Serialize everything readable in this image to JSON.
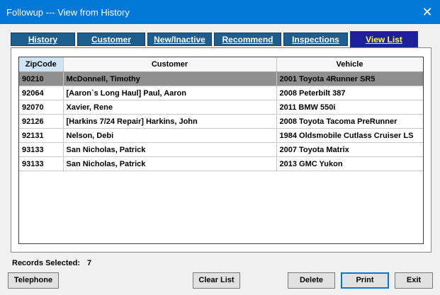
{
  "window": {
    "title": "Followup --- View from History",
    "close_glyph": "✕"
  },
  "tabs": [
    {
      "label": "History"
    },
    {
      "label": "Customer"
    },
    {
      "label": "New/Inactive"
    },
    {
      "label": "Recommend"
    },
    {
      "label": "Inspections"
    },
    {
      "label": "View List",
      "active": true
    }
  ],
  "table": {
    "columns": [
      "ZipCode",
      "Customer",
      "Vehicle"
    ],
    "sorted_column": "ZipCode",
    "rows": [
      {
        "zip": "90210",
        "customer": "McDonnell, Timothy",
        "vehicle": "2001 Toyota 4Runner SR5",
        "selected": true
      },
      {
        "zip": "92064",
        "customer": "[Aaron`s Long Haul] Paul, Aaron",
        "vehicle": "2008 Peterbilt 387"
      },
      {
        "zip": "92070",
        "customer": "Xavier, Rene",
        "vehicle": "2011 BMW 550i"
      },
      {
        "zip": "92126",
        "customer": "[Harkins 7/24 Repair] Harkins, John",
        "vehicle": "2008 Toyota Tacoma PreRunner"
      },
      {
        "zip": "92131",
        "customer": "Nelson, Debi",
        "vehicle": "1984 Oldsmobile Cutlass Cruiser LS"
      },
      {
        "zip": "93133",
        "customer": "San Nicholas, Patrick",
        "vehicle": "2007 Toyota Matrix"
      },
      {
        "zip": "93133",
        "customer": "San Nicholas, Patrick",
        "vehicle": "2013 GMC Yukon"
      }
    ]
  },
  "footer": {
    "records_label": "Records Selected:",
    "records_count": "7",
    "buttons": {
      "telephone": "Telephone",
      "clear_list": "Clear List",
      "delete": "Delete",
      "print": "Print",
      "exit": "Exit"
    }
  }
}
